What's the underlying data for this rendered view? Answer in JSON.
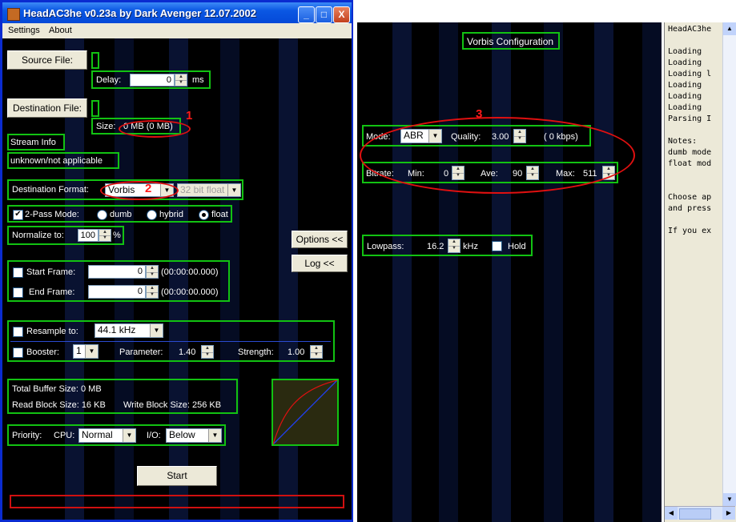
{
  "window": {
    "title": "HeadAC3he v0.23a by Dark Avenger 12.07.2002",
    "controls": {
      "minimize": "_",
      "maximize": "□",
      "close": "X"
    }
  },
  "menu": {
    "items": [
      "Settings",
      "About"
    ]
  },
  "main": {
    "source_file_button": "Source File:",
    "delay_label": "Delay:",
    "delay_value": "0",
    "delay_unit": "ms",
    "destination_file_button": "Destination File:",
    "size_label": "Size:",
    "size_value": "0 MB  (0 MB)",
    "stream_info_label": "Stream Info",
    "stream_info_value": "unknown/not applicable",
    "dest_format_label": "Destination Format:",
    "dest_format_value": "Vorbis",
    "bit_format_value": "32 bit float",
    "two_pass_label": "2-Pass Mode:",
    "mode_dumb": "dumb",
    "mode_hybrid": "hybrid",
    "mode_float": "float",
    "normalize_label": "Normalize to:",
    "normalize_value": "100",
    "normalize_unit": "%",
    "options_button": "Options <<",
    "log_button": "Log <<",
    "start_frame_label": "Start Frame:",
    "start_frame_value": "0",
    "start_frame_time": "(00:00:00.000)",
    "end_frame_label": "End Frame:",
    "end_frame_value": "0",
    "end_frame_time": "(00:00:00.000)",
    "resample_label": "Resample to:",
    "resample_value": "44.1 kHz",
    "booster_label": "Booster:",
    "booster_value": "1",
    "parameter_label": "Parameter:",
    "parameter_value": "1.40",
    "strength_label": "Strength:",
    "strength_value": "1.00",
    "total_buffer": "Total Buffer Size:    0 MB",
    "read_block": "Read Block Size: 16 KB",
    "write_block": "Write Block Size:  256 KB",
    "priority_label": "Priority:",
    "cpu_label": "CPU:",
    "cpu_value": "Normal",
    "io_label": "I/O:",
    "io_value": "Below",
    "start_button": "Start",
    "annotations": {
      "a1": "1",
      "a2": "2",
      "a3": "3"
    }
  },
  "vorbis": {
    "title": "Vorbis Configuration",
    "mode_label": "Mode:",
    "mode_value": "ABR",
    "quality_label": "Quality:",
    "quality_value": "3.00",
    "kbps_text": "(  0 kbps)",
    "bitrate_label": "Bitrate:",
    "min_label": "Min:",
    "min_value": "0",
    "ave_label": "Ave:",
    "ave_value": "90",
    "max_label": "Max:",
    "max_value": "511",
    "lowpass_label": "Lowpass:",
    "lowpass_value": "16.2",
    "lowpass_unit": "kHz",
    "hold_label": "Hold"
  },
  "log": {
    "text": "HeadAC3he\n\nLoading\nLoading\nLoading l\nLoading\nLoading\nLoading\nParsing I\n\nNotes:\ndumb mode\nfloat mod\n\n\nChoose ap\nand press\n\nIf you ex"
  },
  "colors": {
    "accent_green": "#12c212",
    "annotation_red": "#e01010",
    "titlebar_blue": "#0a57e3",
    "panel_bg": "#000000"
  }
}
